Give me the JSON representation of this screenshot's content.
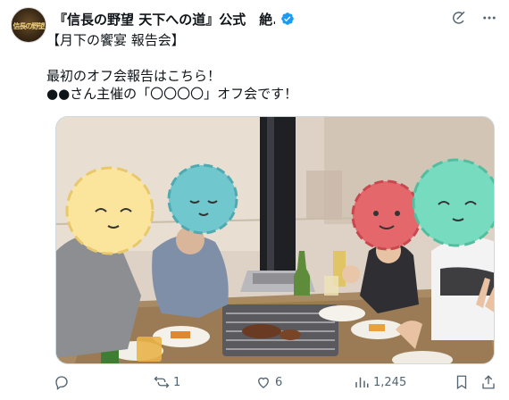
{
  "post": {
    "avatar_text": "信長の野望",
    "display_name": "『信長の野望 天下への道』公式　絶...",
    "lines": [
      "【月下の饗宴 報告会】",
      "",
      "最初のオフ会報告はこちら！",
      "●●さん主催の「〇〇〇〇」オフ会です！"
    ],
    "text": "【月下の饗宴 報告会】\n\n最初のオフ会報告はこちら！\n●●さん主催の「〇〇〇〇」オフ会です！"
  },
  "icons": {
    "verified": "verified-badge-icon",
    "grok": "grok-icon",
    "more": "more-icon",
    "reply": "reply-icon",
    "retweet": "retweet-icon",
    "like": "heart-icon",
    "views": "views-icon",
    "bookmark": "bookmark-icon",
    "share": "share-icon"
  },
  "actions": {
    "retweets": "1",
    "likes": "6",
    "views": "1,245"
  },
  "colors": {
    "verified": "#1d9bf0",
    "secondary_text": "#536471"
  }
}
